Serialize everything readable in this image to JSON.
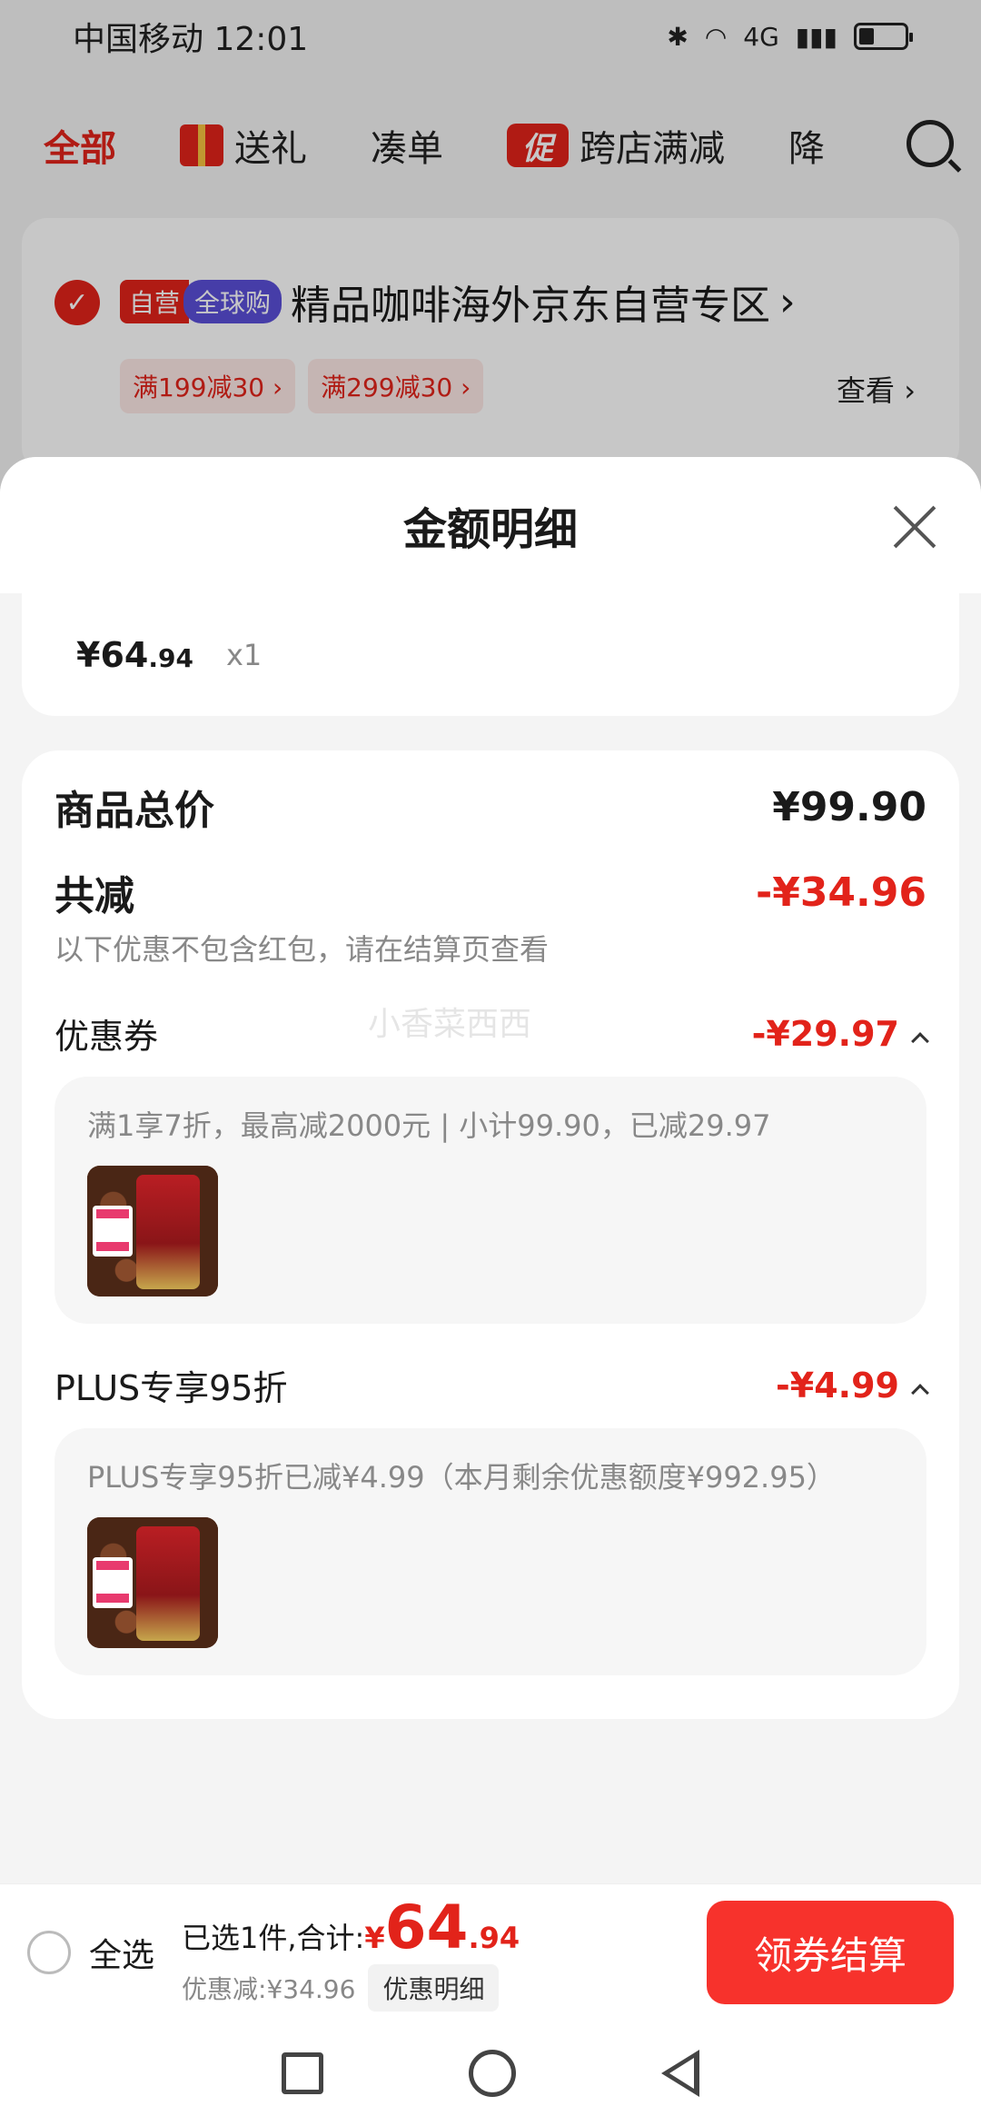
{
  "status_bar": {
    "carrier": "中国移动",
    "time": "12:01",
    "network": "4G"
  },
  "tabs": [
    {
      "label": "全部",
      "active": true
    },
    {
      "label": "送礼",
      "icon": "gift-icon"
    },
    {
      "label": "凑单"
    },
    {
      "label": "跨店满减",
      "badge": "促"
    },
    {
      "label": "降"
    }
  ],
  "store": {
    "tag_self": "自营",
    "tag_global": "全球购",
    "title": "精品咖啡海外京东自营专区",
    "coupons": [
      "满199减30 ›",
      "满299减30 ›"
    ],
    "view_label": "查看 ›"
  },
  "sheet": {
    "title": "金额明细",
    "item": {
      "price_int": "¥64",
      "price_dec": ".94",
      "qty": "x1"
    },
    "total_label": "商品总价",
    "total_value": "¥99.90",
    "reduce_label": "共减",
    "reduce_value": "-¥34.96",
    "reduce_note": "以下优惠不包含红包，请在结算页查看",
    "coupon_section": {
      "label": "优惠券",
      "value": "-¥29.97",
      "desc": "满1享7折，最高减2000元 | 小计99.90，已减29.97"
    },
    "plus_section": {
      "label": "PLUS专享95折",
      "value": "-¥4.99",
      "desc": "PLUS专享95折已减¥4.99（本月剩余优惠额度¥992.95）"
    },
    "watermark": "小香菜西西"
  },
  "bottom_bar": {
    "select_all": "全选",
    "selected_text": "已选1件,合计:",
    "total_symbol": "¥",
    "total_int": "64",
    "total_dec": ".94",
    "discount_text": "优惠减:¥34.96",
    "detail_button": "优惠明细",
    "checkout_button": "领券结算"
  },
  "colors": {
    "accent": "#e2231a",
    "checkout": "#f7322c",
    "global_tag": "#5a4fd8"
  }
}
